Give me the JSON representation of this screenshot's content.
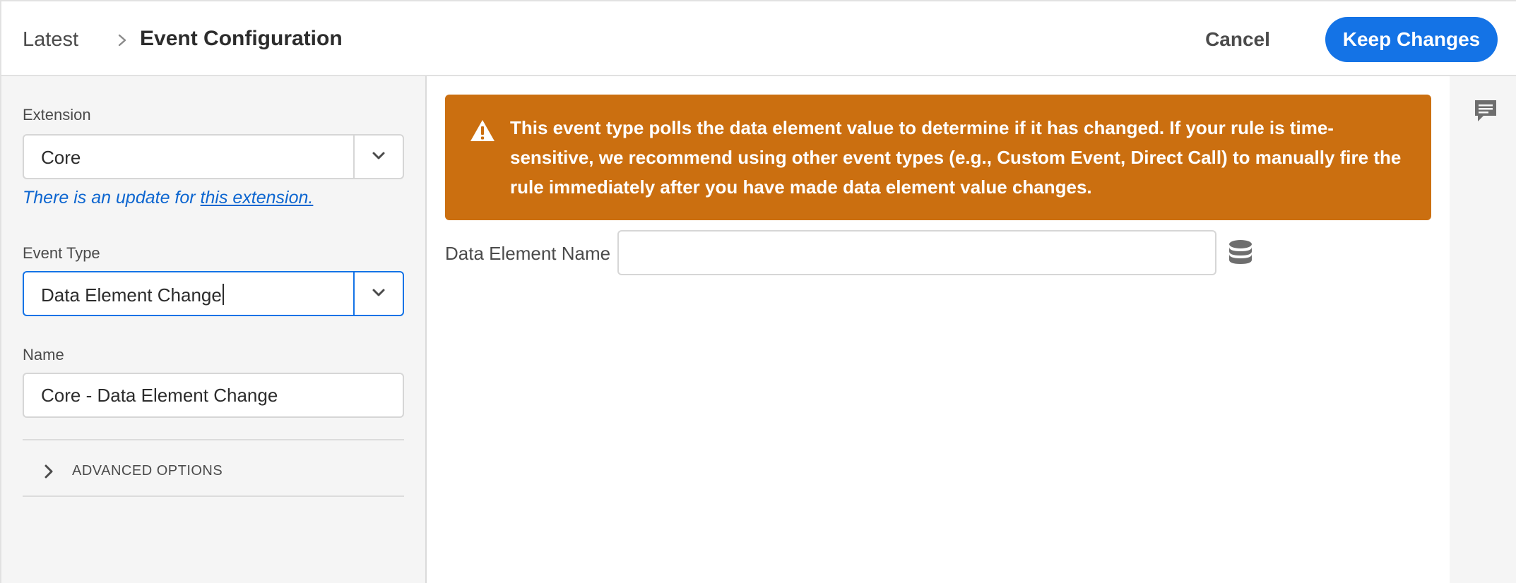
{
  "header": {
    "breadcrumb_root": "Latest",
    "title": "Event Configuration",
    "cancel_label": "Cancel",
    "keep_label": "Keep Changes"
  },
  "left": {
    "extension": {
      "label": "Extension",
      "value": "Core",
      "update_note": "There is an update for ",
      "update_link": "this extension."
    },
    "event_type": {
      "label": "Event Type",
      "value": "Data Element Change"
    },
    "name": {
      "label": "Name",
      "value": "Core - Data Element Change"
    },
    "advanced_label": "ADVANCED OPTIONS"
  },
  "main": {
    "alert_text": "This event type polls the data element value to determine if it has changed. If your rule is time-sensitive, we recommend using other event types (e.g., Custom Event, Direct Call) to manually fire the rule immediately after you have made data element value changes.",
    "data_element_label": "Data Element Name",
    "data_element_value": ""
  },
  "colors": {
    "accent": "#1473e6",
    "warning": "#cb6f10",
    "link": "#0d66d0"
  },
  "icons": {
    "breadcrumb": "chevron-right-icon",
    "picker": "chevron-down-icon",
    "warning": "alert-triangle-icon",
    "data_element": "database-icon",
    "comment": "comment-icon"
  }
}
